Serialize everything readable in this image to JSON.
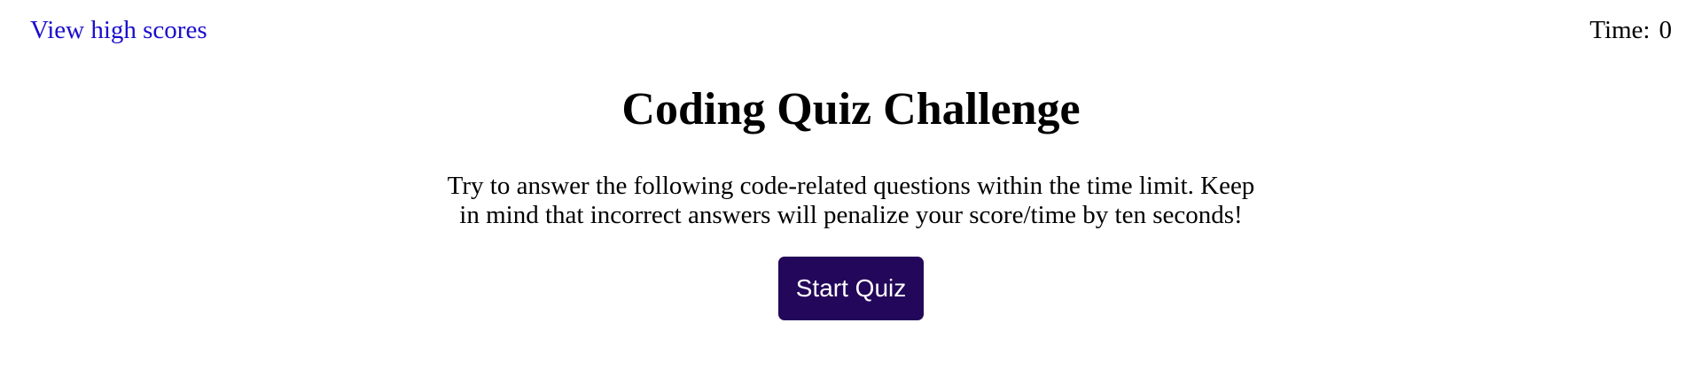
{
  "header": {
    "high_scores_label": "View high scores",
    "timer_label": "Time:",
    "timer_value": "0"
  },
  "main": {
    "title": "Coding Quiz Challenge",
    "instructions": "Try to answer the following code-related questions within the time limit. Keep in mind that incorrect answers will penalize your score/time by ten seconds!",
    "start_button_label": "Start Quiz"
  },
  "colors": {
    "link": "#1a0dcc",
    "button_background": "#23075a",
    "button_text": "#ffffff"
  }
}
